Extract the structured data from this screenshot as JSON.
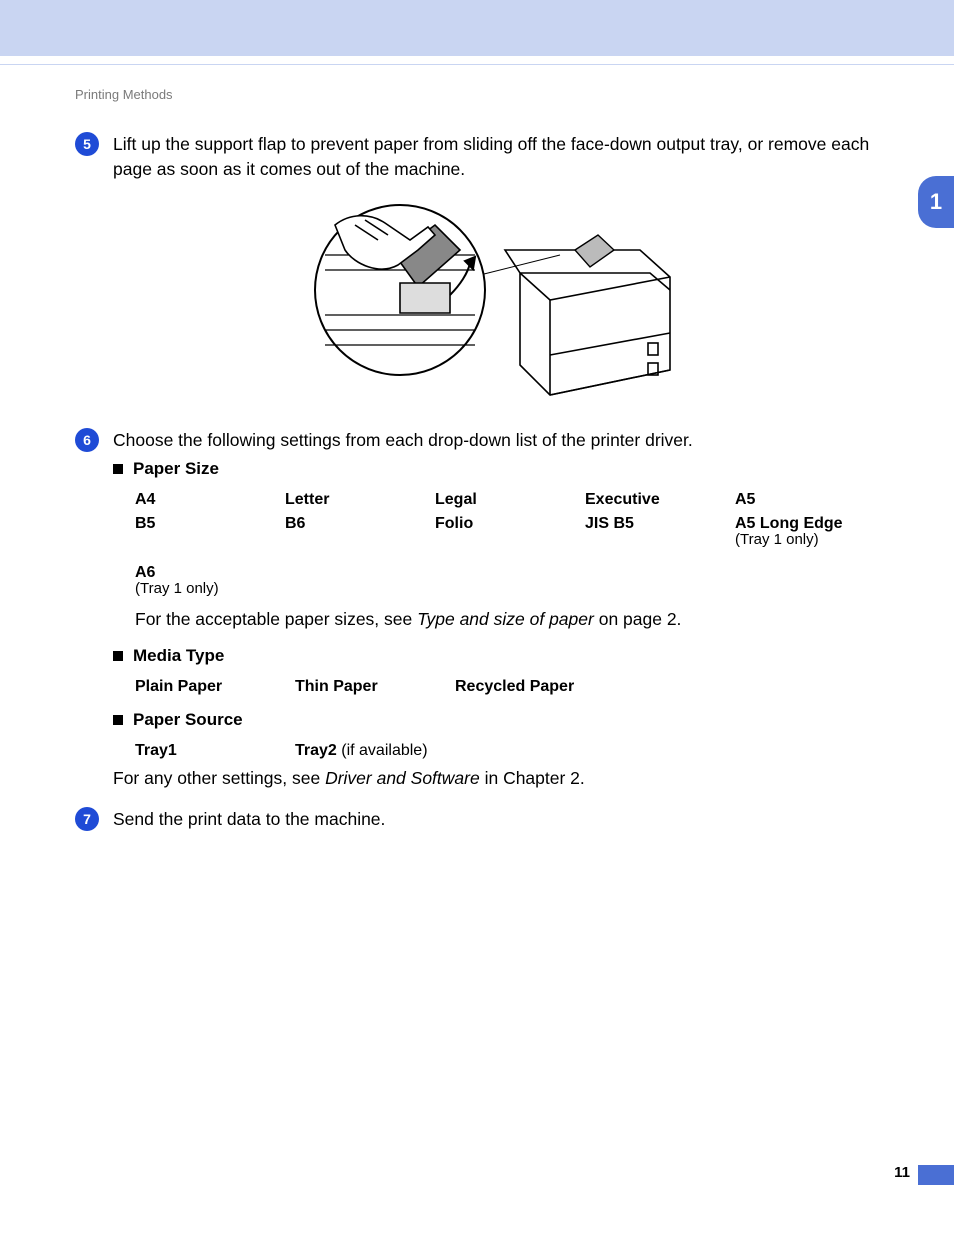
{
  "header": {
    "breadcrumb": "Printing Methods"
  },
  "side_tab": "1",
  "page_number": "11",
  "steps": {
    "s5": {
      "num": "5",
      "text": "Lift up the support flap to prevent paper from sliding off the face-down output tray, or remove each page as soon as it comes out of the machine."
    },
    "s6": {
      "num": "6",
      "text": "Choose the following settings from each drop-down list of the printer driver.",
      "paper_size": {
        "label": "Paper Size",
        "row1": [
          "A4",
          "Letter",
          "Legal",
          "Executive",
          "A5"
        ],
        "row2": [
          "B5",
          "B6",
          "Folio",
          "JIS B5",
          "A5 Long Edge"
        ],
        "row2_note": "(Tray 1 only)",
        "row3": [
          "A6"
        ],
        "row3_note": "(Tray 1 only)",
        "footer_a": "For the acceptable paper sizes, see ",
        "footer_i": "Type and size of paper",
        "footer_b": " on page 2."
      },
      "media_type": {
        "label": "Media Type",
        "items": [
          "Plain Paper",
          "Thin Paper",
          "Recycled Paper"
        ]
      },
      "paper_source": {
        "label": "Paper Source",
        "c1": "Tray1",
        "c2a": "Tray2",
        "c2b": " (if available)"
      },
      "closing_a": "For any other settings, see ",
      "closing_i": "Driver and Software",
      "closing_b": " in Chapter 2."
    },
    "s7": {
      "num": "7",
      "text": "Send the print data to the machine."
    }
  }
}
